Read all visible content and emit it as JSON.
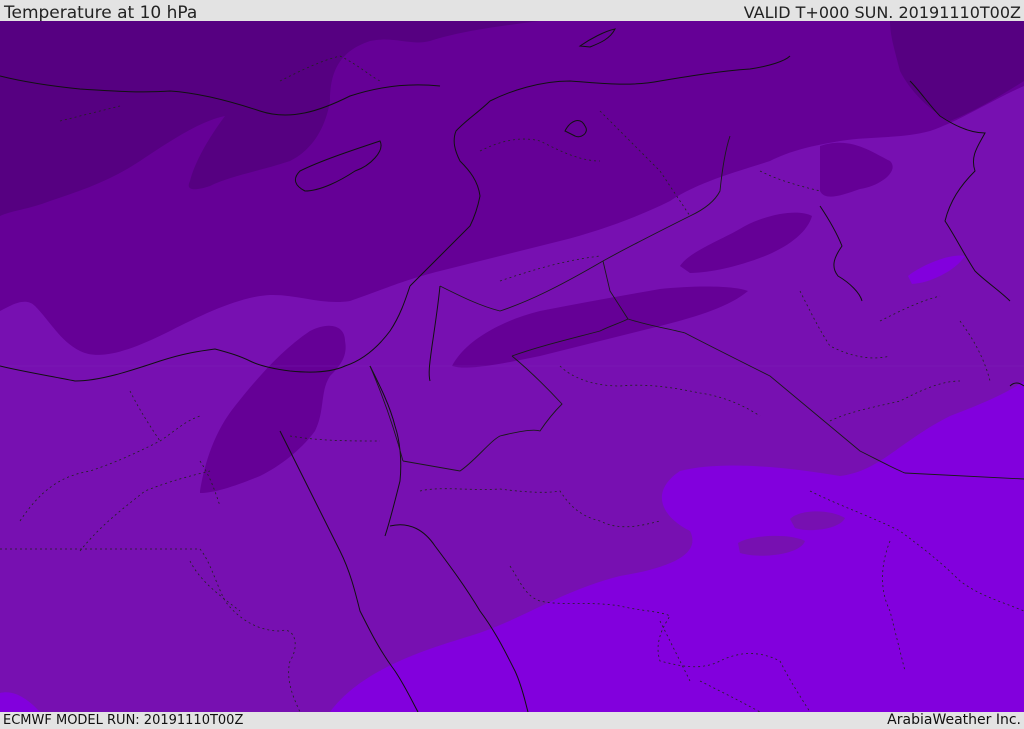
{
  "header": {
    "title": "Temperature at 10 hPa",
    "valid": "VALID T+000 SUN. 20191110T00Z"
  },
  "footer": {
    "model_run": "ECMWF MODEL RUN: 20191110T00Z",
    "brand": "ArabiaWeather Inc."
  },
  "colors": {
    "band_coldest": "#560081",
    "band_cold": "#650096",
    "band_mid": "#7710b1",
    "band_warm": "#8200dd",
    "coastline": "#111111",
    "border": "#1a1a1a"
  }
}
